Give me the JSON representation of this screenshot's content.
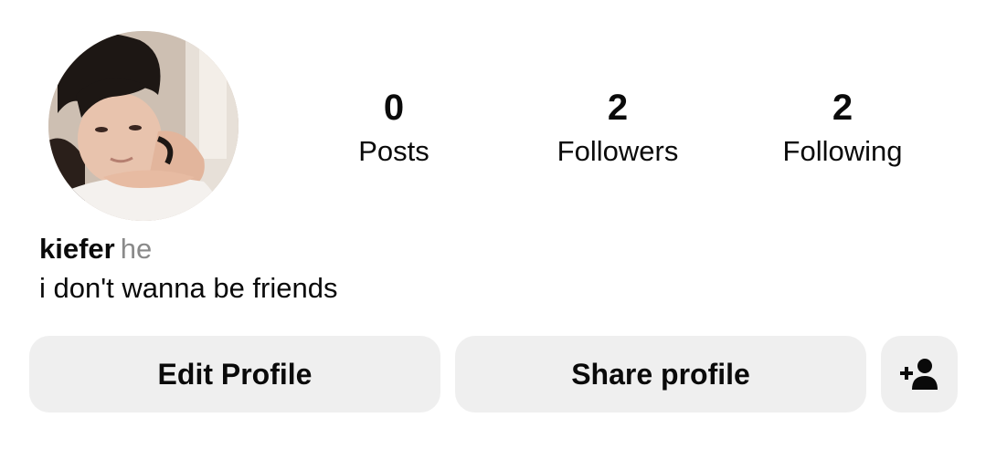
{
  "profile": {
    "username": "kiefer",
    "pronouns": "he",
    "bio": "i don't wanna be friends"
  },
  "stats": {
    "posts": {
      "count": "0",
      "label": "Posts"
    },
    "followers": {
      "count": "2",
      "label": "Followers"
    },
    "following": {
      "count": "2",
      "label": "Following"
    }
  },
  "actions": {
    "edit_label": "Edit Profile",
    "share_label": "Share profile",
    "add_icon": "add-person-icon"
  },
  "colors": {
    "button_bg": "#efefef",
    "pronoun_text": "#8a8a8a",
    "text": "#0a0a0a"
  }
}
